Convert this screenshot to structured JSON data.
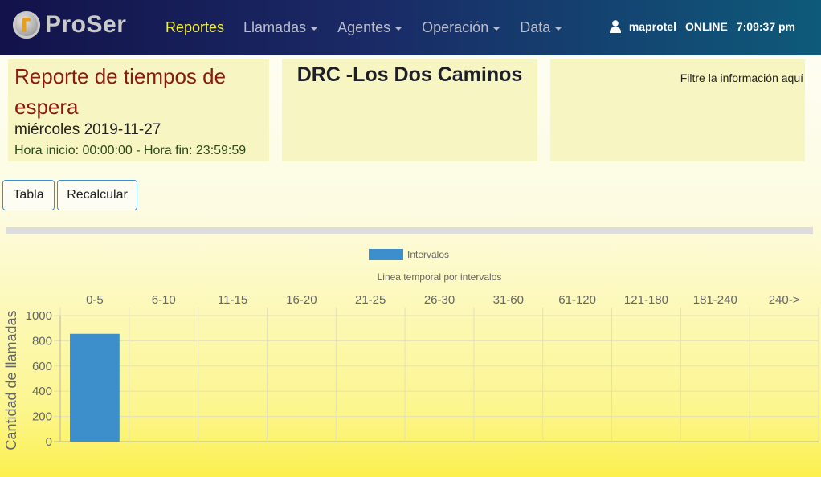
{
  "navbar": {
    "brand": "ProSer",
    "items": [
      {
        "label": "Reportes",
        "active": true,
        "dropdown": false
      },
      {
        "label": "Llamadas",
        "active": false,
        "dropdown": true
      },
      {
        "label": "Agentes",
        "active": false,
        "dropdown": true
      },
      {
        "label": "Operación",
        "active": false,
        "dropdown": true
      },
      {
        "label": "Data",
        "active": false,
        "dropdown": true
      }
    ],
    "user": "maprotel",
    "status": "ONLINE",
    "time": "7:09:37 pm"
  },
  "header": {
    "title": "Reporte de tiempos de espera",
    "date": "miércoles 2019-11-27",
    "hours": "Hora inicio: 00:00:00 - Hora fin: 23:59:59",
    "center": "DRC -Los Dos Caminos",
    "filter": "Filtre la información aquí"
  },
  "buttons": {
    "tabla": "Tabla",
    "recalcular": "Recalcular"
  },
  "colors": {
    "accent": "#f2ef3c",
    "bar": "#3d8fcc",
    "title": "#8b1a10"
  },
  "chart_data": {
    "type": "bar",
    "title": "Linea temporal por intervalos",
    "legend": "Intervalos",
    "legend_position": "top",
    "x_axis_position": "top",
    "categories": [
      "0-5",
      "6-10",
      "11-15",
      "16-20",
      "21-25",
      "26-30",
      "31-60",
      "61-120",
      "121-180",
      "181-240",
      "240->"
    ],
    "series": [
      {
        "name": "Intervalos",
        "values": [
          855,
          0,
          0,
          0,
          0,
          0,
          0,
          0,
          0,
          0,
          0
        ]
      }
    ],
    "ylabel": "Cantidad de llamadas",
    "xlabel": "",
    "ylim": [
      0,
      1000
    ],
    "yticks": [
      0,
      200,
      400,
      600,
      800,
      1000
    ],
    "grid": true
  }
}
